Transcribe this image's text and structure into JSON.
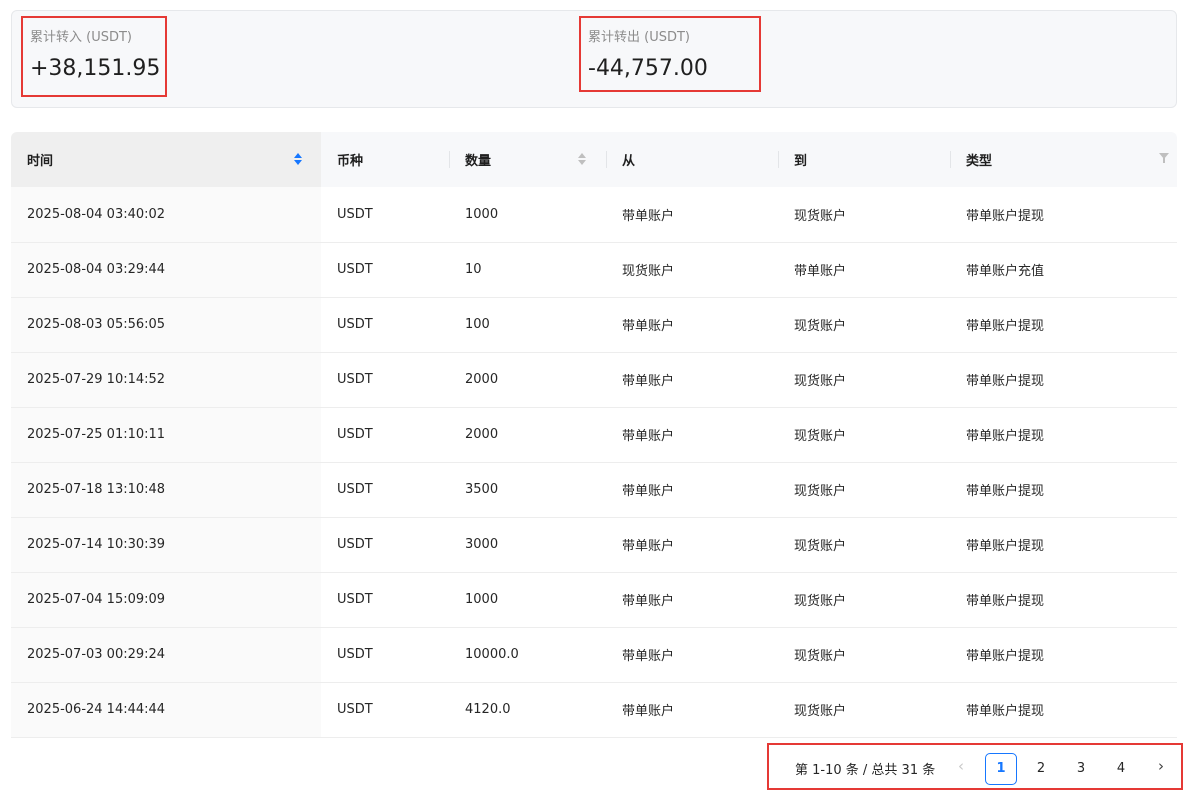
{
  "summary": {
    "transfer_in": {
      "label": "累计转入 (USDT)",
      "value": "+38,151.95"
    },
    "transfer_out": {
      "label": "累计转出 (USDT)",
      "value": "-44,757.00"
    }
  },
  "table": {
    "headers": {
      "time": "时间",
      "coin": "币种",
      "amount": "数量",
      "from": "从",
      "to": "到",
      "type": "类型"
    },
    "rows": [
      {
        "time": "2025-08-04 03:40:02",
        "coin": "USDT",
        "amount": "1000",
        "from": "带单账户",
        "to": "现货账户",
        "type": "带单账户提现"
      },
      {
        "time": "2025-08-04 03:29:44",
        "coin": "USDT",
        "amount": "10",
        "from": "现货账户",
        "to": "带单账户",
        "type": "带单账户充值"
      },
      {
        "time": "2025-08-03 05:56:05",
        "coin": "USDT",
        "amount": "100",
        "from": "带单账户",
        "to": "现货账户",
        "type": "带单账户提现"
      },
      {
        "time": "2025-07-29 10:14:52",
        "coin": "USDT",
        "amount": "2000",
        "from": "带单账户",
        "to": "现货账户",
        "type": "带单账户提现"
      },
      {
        "time": "2025-07-25 01:10:11",
        "coin": "USDT",
        "amount": "2000",
        "from": "带单账户",
        "to": "现货账户",
        "type": "带单账户提现"
      },
      {
        "time": "2025-07-18 13:10:48",
        "coin": "USDT",
        "amount": "3500",
        "from": "带单账户",
        "to": "现货账户",
        "type": "带单账户提现"
      },
      {
        "time": "2025-07-14 10:30:39",
        "coin": "USDT",
        "amount": "3000",
        "from": "带单账户",
        "to": "现货账户",
        "type": "带单账户提现"
      },
      {
        "time": "2025-07-04 15:09:09",
        "coin": "USDT",
        "amount": "1000",
        "from": "带单账户",
        "to": "现货账户",
        "type": "带单账户提现"
      },
      {
        "time": "2025-07-03 00:29:24",
        "coin": "USDT",
        "amount": "10000.0",
        "from": "带单账户",
        "to": "现货账户",
        "type": "带单账户提现"
      },
      {
        "time": "2025-06-24 14:44:44",
        "coin": "USDT",
        "amount": "4120.0",
        "from": "带单账户",
        "to": "现货账户",
        "type": "带单账户提现"
      }
    ]
  },
  "pagination": {
    "total_text": "第 1-10 条 / 总共 31 条",
    "prev_icon": "‹",
    "next_icon": "›",
    "pages": [
      "1",
      "2",
      "3",
      "4"
    ],
    "current": "1"
  },
  "colors": {
    "accent": "#1677ff",
    "highlight_box": "#e53935"
  },
  "icons": {
    "sort": "sort-icon",
    "filter": "filter-icon",
    "prev": "chevron-left-icon",
    "next": "chevron-right-icon"
  }
}
